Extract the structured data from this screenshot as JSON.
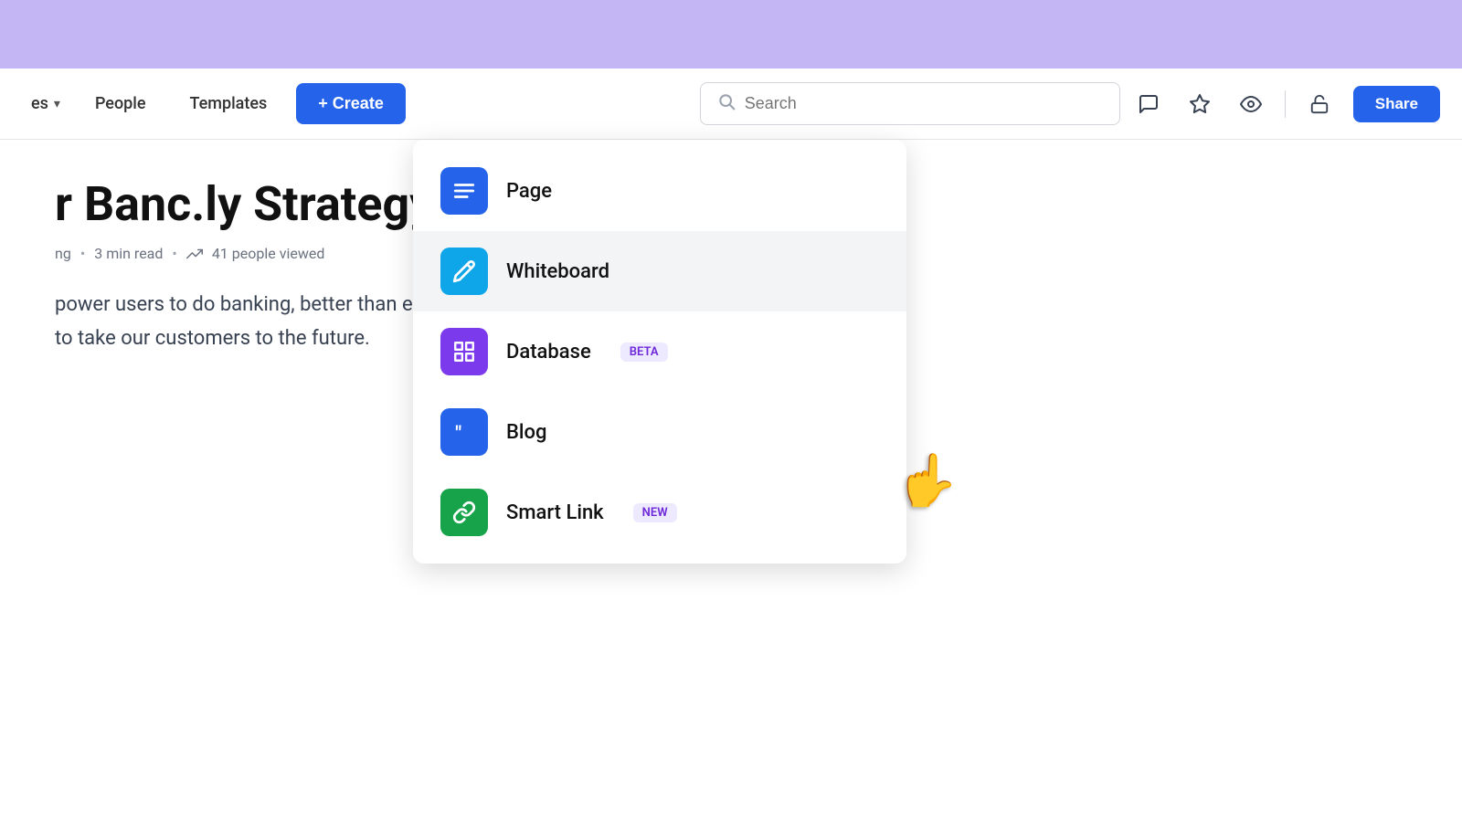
{
  "topBanner": {},
  "navbar": {
    "spaces_label": "es",
    "people_label": "People",
    "templates_label": "Templates",
    "create_label": "+ Create",
    "search_placeholder": "Search"
  },
  "actionIcons": {
    "comment_icon": "💬",
    "star_icon": "☆",
    "eye_icon": "◉",
    "lock_icon": "🔓",
    "share_label": "Share"
  },
  "content": {
    "title": "r Banc.ly Strategy",
    "meta_author": "ng",
    "meta_read": "3 min read",
    "meta_views": "41 people viewed",
    "description_line1": "power users to do banking, better than ever. We are a credit card company",
    "description_line2": "to take our customers to the future."
  },
  "dropdown": {
    "items": [
      {
        "id": "page",
        "label": "Page",
        "badge": null,
        "icon_type": "page"
      },
      {
        "id": "whiteboard",
        "label": "Whiteboard",
        "badge": null,
        "icon_type": "whiteboard"
      },
      {
        "id": "database",
        "label": "Database",
        "badge": "BETA",
        "badge_class": "badge-beta",
        "icon_type": "database"
      },
      {
        "id": "blog",
        "label": "Blog",
        "badge": null,
        "icon_type": "blog"
      },
      {
        "id": "smartlink",
        "label": "Smart Link",
        "badge": "NEW",
        "badge_class": "badge-new",
        "icon_type": "smartlink"
      }
    ]
  }
}
